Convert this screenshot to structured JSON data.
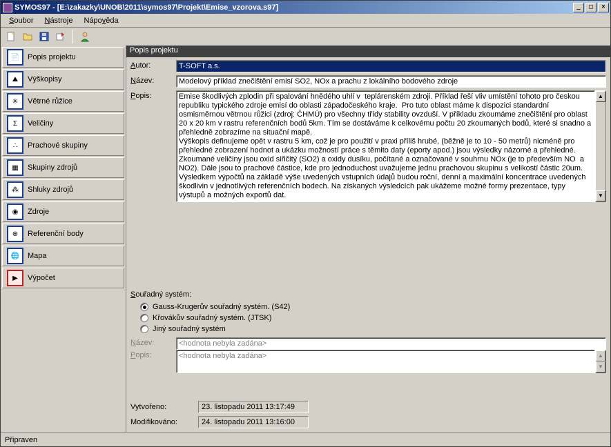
{
  "window": {
    "title": "SYMOS97 - [E:\\zakazky\\UNOB\\2011\\symos97\\Projekt\\Emise_vzorova.s97]"
  },
  "menu": {
    "soubor": "Soubor",
    "nastroje": "Nástroje",
    "napoveda": "Nápověda"
  },
  "sidebar": [
    "Popis projektu",
    "Výškopisy",
    "Větrné růžice",
    "Veličiny",
    "Prachové skupiny",
    "Skupiny zdrojů",
    "Shluky zdrojů",
    "Zdroje",
    "Referenční body",
    "Mapa",
    "Výpočet"
  ],
  "panel": {
    "title": "Popis projektu",
    "author_label": "Autor:",
    "author_value": "T-SOFT a.s.",
    "name_label": "Název:",
    "name_value": "Modelový příklad znečištění emisí SO2, NOx  a prachu  z lokálního bodového zdroje",
    "desc_label": "Popis:",
    "desc_value": "Emise škodlivých zplodin při spalování hnědého uhlí v  teplárenském zdroji. Příklad řeší vliv umístění tohoto pro českou republiku typického zdroje emisí do oblasti západočeského kraje.  Pro tuto oblast máme k dispozici standardní osmisměrnou větrnou růžici (zdroj: ČHMÚ) pro všechny třídy stability ovzduší. V příkladu zkoumáme znečištění pro oblast 20 x 20 km v rastru referenčních bodů 5km. Tím se dostáváme k celkovému počtu 20 zkoumaných bodů, které si snadno a přehledně zobrazíme na situační mapě.\nVýškopis definujeme opět v rastru 5 km, což je pro použití v praxi příliš hrubé, (běžně je to 10 - 50 metrů) nicméně pro přehledné zobrazení hodnot a ukázku možností práce s těmito daty (eporty apod.) jsou výsledky názorné a přehledné.\nZkoumané veličiny jsou oxid siřičitý (SO2) a oxidy dusíku, počítané a označované v souhrnu NOx (je to především NO  a NO2). Dále jsou to prachové částice, kde pro jednoduchost uvažujeme jednu prachovou skupinu s velikostí částic 20um.\nVýsledkem výpočtů na základě výše uvedených vstupních údajů budou roční, denní a maximální koncentrace uvedených škodlivin v jednotlivých referenčních bodech. Na získaných výsledcích pak ukážeme možné formy prezentace, typy výstupů a možných exportů dat."
  },
  "coord": {
    "group_label": "Souřadný systém:",
    "gauss": "Gauss-Krugerův souřadný systém. (S42)",
    "krovak": "Křovákův souřadný systém. (JTSK)",
    "other": "Jiný souřadný systém",
    "name_label": "Název:",
    "name_placeholder": "<hodnota nebyla zadána>",
    "desc_label": "Popis:",
    "desc_placeholder": "<hodnota nebyla zadána>"
  },
  "timestamps": {
    "created_label": "Vytvořeno:",
    "created_value": "23. listopadu 2011 13:17:49",
    "modified_label": "Modifikováno:",
    "modified_value": "24. listopadu 2011 13:16:00"
  },
  "status": "Připraven"
}
